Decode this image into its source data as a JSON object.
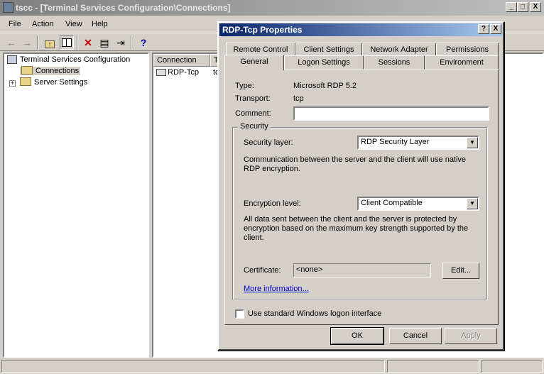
{
  "window": {
    "title": "tscc - [Terminal Services Configuration\\Connections]",
    "minimize": "_",
    "maximize": "□",
    "close": "X"
  },
  "menu": {
    "file": "File",
    "action": "Action",
    "view": "View",
    "help": "Help"
  },
  "toolbar": {
    "icons": [
      "back-arrow-icon",
      "forward-arrow-icon",
      "up-folder-icon",
      "show-hide-tree-icon",
      "delete-icon",
      "properties-icon",
      "export-list-icon",
      "help-icon"
    ]
  },
  "tree": {
    "root": "Terminal Services Configuration",
    "connections": "Connections",
    "server_settings": "Server Settings"
  },
  "list": {
    "headers": [
      "Connection",
      "T"
    ],
    "rows": [
      {
        "connection": "RDP-Tcp",
        "transport": "tc"
      }
    ]
  },
  "dialog": {
    "title": "RDP-Tcp Properties",
    "help_btn": "?",
    "close_btn": "X",
    "tabs_back": [
      "Remote Control",
      "Client Settings",
      "Network Adapter",
      "Permissions"
    ],
    "tabs_front": [
      "General",
      "Logon Settings",
      "Sessions",
      "Environment"
    ],
    "active_tab": "General",
    "type_label": "Type:",
    "type_value": "Microsoft RDP 5.2",
    "transport_label": "Transport:",
    "transport_value": "tcp",
    "comment_label": "Comment:",
    "comment_value": "",
    "security": {
      "group_label": "Security",
      "layer_label": "Security layer:",
      "layer_value": "RDP Security Layer",
      "layer_desc": "Communication between the server and the client will use native RDP encryption.",
      "encryption_label": "Encryption level:",
      "encryption_value": "Client Compatible",
      "encryption_desc": "All data sent between the client and the server is protected by encryption based on the maximum key strength supported by the client.",
      "certificate_label": "Certificate:",
      "certificate_value": "<none>",
      "edit_btn": "Edit...",
      "more_info": "More information..."
    },
    "logon_checkbox_label": "Use standard Windows logon interface",
    "logon_checkbox_checked": false,
    "ok": "OK",
    "cancel": "Cancel",
    "apply": "Apply"
  },
  "colors": {
    "window_bg": "#d4d0c8",
    "active_title": "#0a246a",
    "inactive_title": "#808080",
    "link": "#0000cc"
  }
}
